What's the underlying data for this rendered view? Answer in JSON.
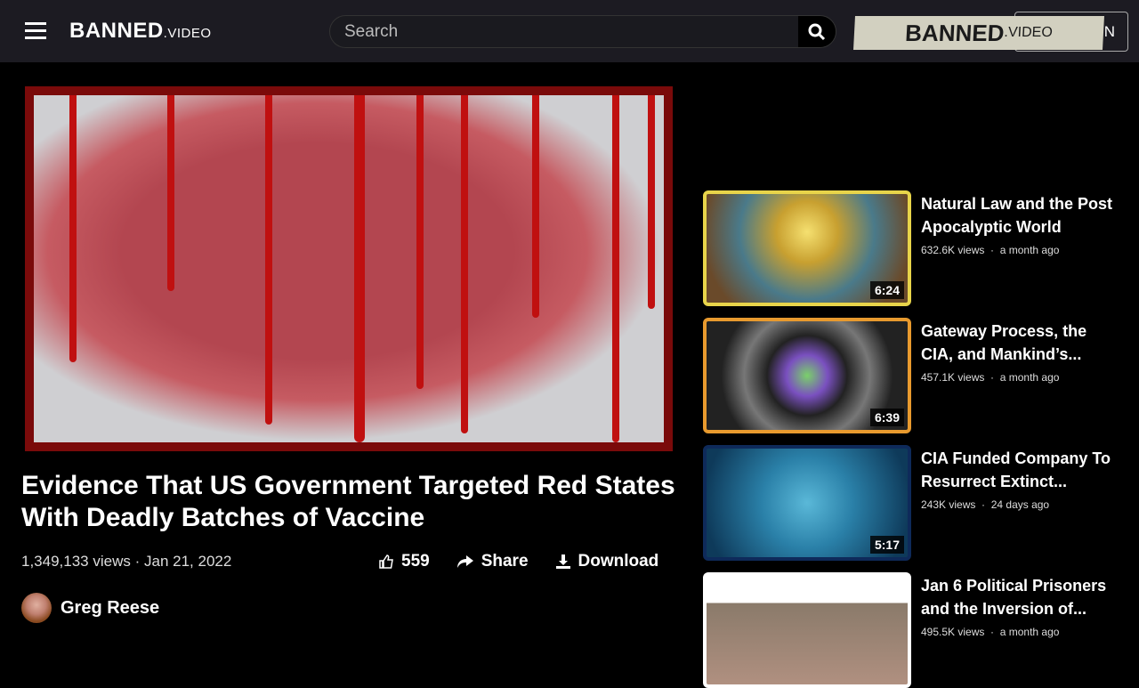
{
  "header": {
    "logo_main": "BANNED",
    "logo_suffix": ".VIDEO",
    "search_placeholder": "Search",
    "banner_main": "BANNED",
    "banner_suffix": ".VIDEO",
    "signin_label": "IN"
  },
  "video": {
    "title": "Evidence That US Government Targeted Red States With Deadly Batches of Vaccine",
    "views": "1,349,133 views",
    "separator": "·",
    "date": "Jan 21, 2022",
    "likes": "559",
    "share_label": "Share",
    "download_label": "Download",
    "author": "Greg Reese"
  },
  "related": [
    {
      "title": "Natural Law and the Post Apocalyptic World",
      "views": "632.6K views",
      "age": "a month ago",
      "duration": "6:24",
      "border": "#e8d44a"
    },
    {
      "title": "Gateway Process, the CIA, and Mankind’s...",
      "views": "457.1K views",
      "age": "a month ago",
      "duration": "6:39",
      "border": "#e89a2e"
    },
    {
      "title": "CIA Funded Company To Resurrect Extinct...",
      "views": "243K views",
      "age": "24 days ago",
      "duration": "5:17",
      "border": "#0e2a5a"
    },
    {
      "title": "Jan 6 Political Prisoners and the Inversion of...",
      "views": "495.5K views",
      "age": "a month ago",
      "duration": "",
      "border": "#ffffff"
    }
  ]
}
